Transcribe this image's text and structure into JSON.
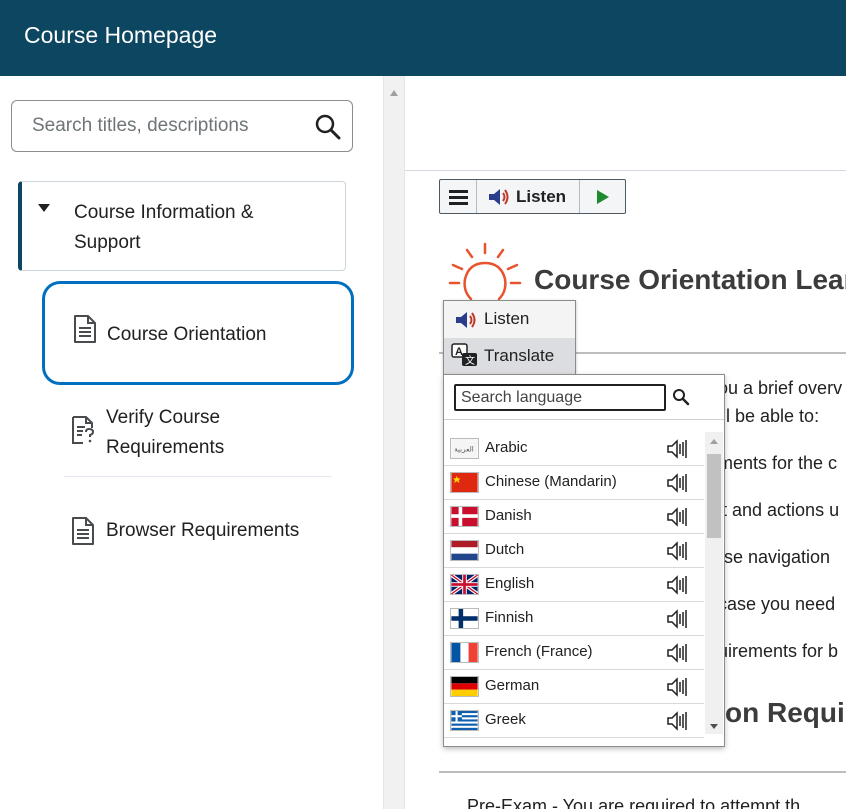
{
  "header": {
    "title": "Course Homepage"
  },
  "sidebar": {
    "search_placeholder": "Search titles, descriptions",
    "module": {
      "label": "Course Information & Support"
    },
    "topics": [
      {
        "label": "Course Orientation",
        "selected": true,
        "icon": "document-icon"
      },
      {
        "label": "Verify Course Requirements",
        "icon": "document-question-icon"
      },
      {
        "label": "Browser Requirements",
        "icon": "document-icon"
      }
    ]
  },
  "toolbar": {
    "listen_label": "Listen"
  },
  "content": {
    "heading": "Course Orientation Learn",
    "lines": [
      "ou a brief overv",
      "ll be able to:",
      "ments for the c",
      "t and actions u",
      "rse navigation",
      "case you need",
      "uirements for b"
    ],
    "heading2": "on Requir",
    "bottom_line": "Pre-Exam - You are required to attempt th"
  },
  "popup_menu": {
    "items": [
      {
        "label": "Listen"
      },
      {
        "label": "Translate",
        "active": true
      }
    ]
  },
  "language_panel": {
    "search_placeholder": "Search language",
    "languages": [
      {
        "name": "Arabic",
        "flag": "arabic-flag"
      },
      {
        "name": "Chinese (Mandarin)",
        "flag": "china-flag"
      },
      {
        "name": "Danish",
        "flag": "denmark-flag"
      },
      {
        "name": "Dutch",
        "flag": "netherlands-flag"
      },
      {
        "name": "English",
        "flag": "uk-flag"
      },
      {
        "name": "Finnish",
        "flag": "finland-flag"
      },
      {
        "name": "French (France)",
        "flag": "france-flag"
      },
      {
        "name": "German",
        "flag": "germany-flag"
      },
      {
        "name": "Greek",
        "flag": "greece-flag"
      }
    ]
  },
  "colors": {
    "header_bg": "#0d4660",
    "selected_border": "#006fbf",
    "accent_orange": "#e8532d",
    "play_green": "#1f8a2c"
  }
}
